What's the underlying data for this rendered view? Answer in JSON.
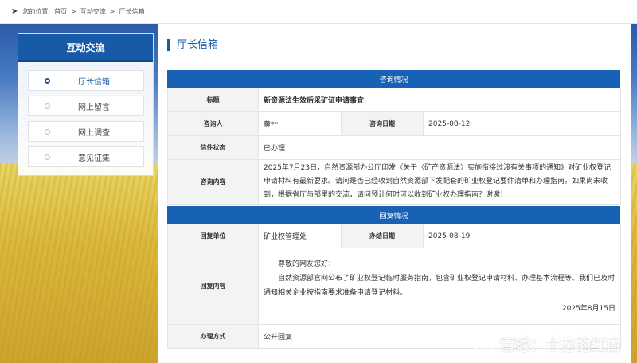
{
  "breadcrumb": {
    "prefix": "您的位置:",
    "home": "首页",
    "sep1": ">",
    "section": "互动交流",
    "sep2": ">",
    "current": "厅长信箱"
  },
  "sidebar": {
    "heading": "互动交流",
    "items": [
      {
        "label": "厅长信箱",
        "active": true
      },
      {
        "label": "网上留言",
        "active": false
      },
      {
        "label": "网上调查",
        "active": false
      },
      {
        "label": "意见征集",
        "active": false
      }
    ]
  },
  "page_title": "厅长信箱",
  "consult": {
    "section_title": "咨询情况",
    "title_label": "标题",
    "title_value": "新资源法生效后采矿证申请事宜",
    "person_label": "咨询人",
    "person_value": "黄**",
    "date_label": "咨询日期",
    "date_value": "2025-08-12",
    "status_label": "信件状态",
    "status_value": "已办理",
    "content_label": "咨询内容",
    "content_value": "2025年7月23日，自然资源部办公厅印发《关于〈矿产资源法〉实施衔接过渡有关事项的通知》对矿业权登记申请材料有最新要求。请问是否已经收到自然资源部下发配套的矿业权登记要件清单和办理指南。如果尚未收到，根据省厅与部里的交流，请问预计何时可以收到矿业权办理指南？谢谢！"
  },
  "reply": {
    "section_title": "回复情况",
    "unit_label": "回复单位",
    "unit_value": "矿业权管理处",
    "done_date_label": "办结日期",
    "done_date_value": "2025-08-19",
    "content_label": "回复内容",
    "greeting": "尊敬的网友您好：",
    "body": "自然资源部官网公布了矿业权登记临时服务指南，包含矿业权登记申请材料、办理基本流程等。我们已及时通知相关企业按指南要求准备申请登记材料。",
    "date": "2025年8月15日",
    "method_label": "办理方式",
    "method_value": "公开回复"
  },
  "watermark": {
    "text": "雪球：十万的红白"
  }
}
